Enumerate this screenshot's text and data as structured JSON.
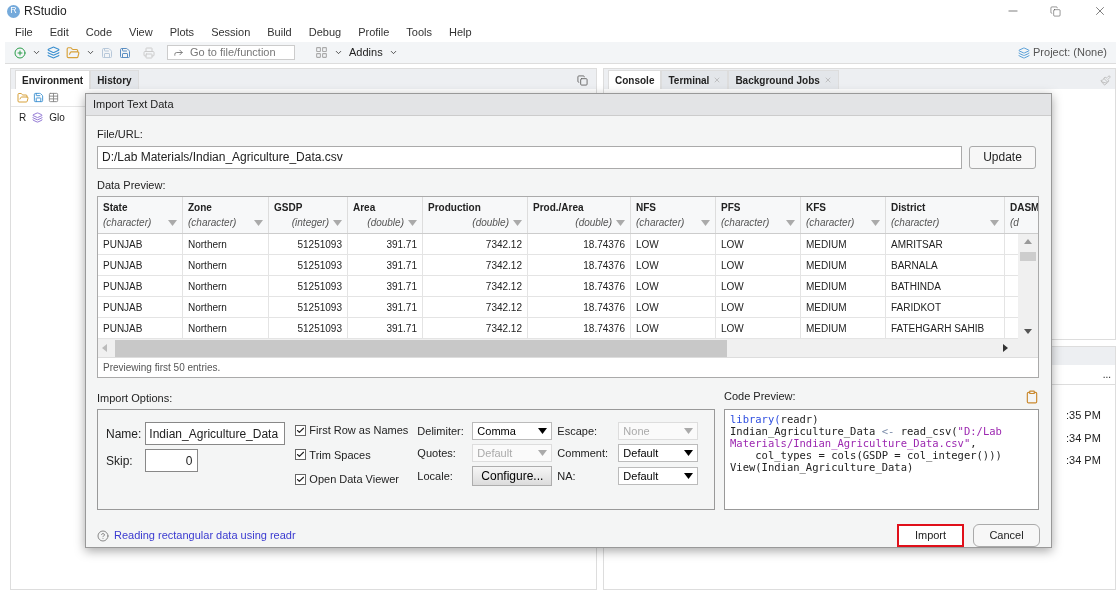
{
  "app": {
    "logo_letter": "R",
    "title": "RStudio"
  },
  "menu": [
    "File",
    "Edit",
    "Code",
    "View",
    "Plots",
    "Session",
    "Build",
    "Debug",
    "Profile",
    "Tools",
    "Help"
  ],
  "toolbar": {
    "goto_placeholder": "Go to file/function",
    "addins": "Addins",
    "project": "Project: (None)"
  },
  "left_pane": {
    "tabs": [
      {
        "label": "Environment",
        "selected": true
      },
      {
        "label": "History",
        "selected": false
      }
    ],
    "lang": "R",
    "env": "Glo"
  },
  "right_pane": {
    "tabs": [
      {
        "label": "Console",
        "selected": true,
        "closable": false
      },
      {
        "label": "Terminal",
        "selected": false,
        "closable": true
      },
      {
        "label": "Background Jobs",
        "selected": false,
        "closable": true
      }
    ],
    "more": "...",
    "times": [
      ":35 PM",
      ":34 PM",
      ":34 PM"
    ]
  },
  "dialog": {
    "title": "Import Text Data",
    "file_label": "File/URL:",
    "file_value": "D:/Lab Materials/Indian_Agriculture_Data.csv",
    "update": "Update",
    "preview_label": "Data Preview:",
    "columns": [
      {
        "name": "State",
        "type": "(character)",
        "kind": "text"
      },
      {
        "name": "Zone",
        "type": "(character)",
        "kind": "text"
      },
      {
        "name": "GSDP",
        "type": "(integer)",
        "kind": "number"
      },
      {
        "name": "Area",
        "type": "(double)",
        "kind": "number"
      },
      {
        "name": "Production",
        "type": "(double)",
        "kind": "number"
      },
      {
        "name": "Prod./Area",
        "type": "(double)",
        "kind": "number"
      },
      {
        "name": "NFS",
        "type": "(character)",
        "kind": "text"
      },
      {
        "name": "PFS",
        "type": "(character)",
        "kind": "text"
      },
      {
        "name": "KFS",
        "type": "(character)",
        "kind": "text"
      },
      {
        "name": "District",
        "type": "(character)",
        "kind": "text"
      },
      {
        "name": "DASM",
        "type": "(d",
        "kind": "text"
      }
    ],
    "rows": [
      [
        "PUNJAB",
        "Northern",
        "51251093",
        "391.71",
        "7342.12",
        "18.74376",
        "LOW",
        "LOW",
        "MEDIUM",
        "AMRITSAR"
      ],
      [
        "PUNJAB",
        "Northern",
        "51251093",
        "391.71",
        "7342.12",
        "18.74376",
        "LOW",
        "LOW",
        "MEDIUM",
        "BARNALA"
      ],
      [
        "PUNJAB",
        "Northern",
        "51251093",
        "391.71",
        "7342.12",
        "18.74376",
        "LOW",
        "LOW",
        "MEDIUM",
        "BATHINDA"
      ],
      [
        "PUNJAB",
        "Northern",
        "51251093",
        "391.71",
        "7342.12",
        "18.74376",
        "LOW",
        "LOW",
        "MEDIUM",
        "FARIDKOT"
      ],
      [
        "PUNJAB",
        "Northern",
        "51251093",
        "391.71",
        "7342.12",
        "18.74376",
        "LOW",
        "LOW",
        "MEDIUM",
        "FATEHGARH SAHIB"
      ]
    ],
    "preview_note": "Previewing first 50 entries.",
    "options_label": "Import Options:",
    "name_label": "Name:",
    "name_value": "Indian_Agriculture_Data",
    "skip_label": "Skip:",
    "skip_value": "0",
    "checkboxes": [
      {
        "label": "First Row as Names",
        "checked": true
      },
      {
        "label": "Trim Spaces",
        "checked": true
      },
      {
        "label": "Open Data Viewer",
        "checked": true
      }
    ],
    "selects": [
      {
        "label": "Delimiter:",
        "value": "Comma",
        "disabled": false,
        "kind": "select"
      },
      {
        "label": "Escape:",
        "value": "None",
        "disabled": true,
        "kind": "select"
      },
      {
        "label": "Quotes:",
        "value": "Default",
        "disabled": true,
        "kind": "select"
      },
      {
        "label": "Comment:",
        "value": "Default",
        "disabled": false,
        "kind": "select"
      },
      {
        "label": "Locale:",
        "value": "Configure...",
        "disabled": false,
        "kind": "button"
      },
      {
        "label": "NA:",
        "value": "Default",
        "disabled": false,
        "kind": "select"
      }
    ],
    "code_label": "Code Preview:",
    "code_lines": [
      [
        {
          "text": "library(",
          "kind": "keyword"
        },
        {
          "text": "readr)",
          "kind": "plain"
        }
      ],
      [
        {
          "text": "Indian_Agriculture_Data ",
          "kind": "plain"
        },
        {
          "text": "<-",
          "kind": "operator"
        },
        {
          "text": " read_csv(",
          "kind": "plain"
        },
        {
          "text": "\"D:/Lab",
          "kind": "string"
        }
      ],
      [
        {
          "text": "Materials/Indian_Agriculture_Data.csv\"",
          "kind": "string"
        },
        {
          "text": ",",
          "kind": "plain"
        }
      ],
      [
        {
          "text": "    col_types = cols(GSDP = col_integer()))",
          "kind": "plain"
        }
      ],
      [
        {
          "text": "View(Indian_Agriculture_Data)",
          "kind": "plain"
        }
      ]
    ],
    "help_link": "Reading rectangular data using readr",
    "buttons": [
      {
        "label": "Import",
        "highlighted": true
      },
      {
        "label": "Cancel",
        "highlighted": false
      }
    ]
  }
}
